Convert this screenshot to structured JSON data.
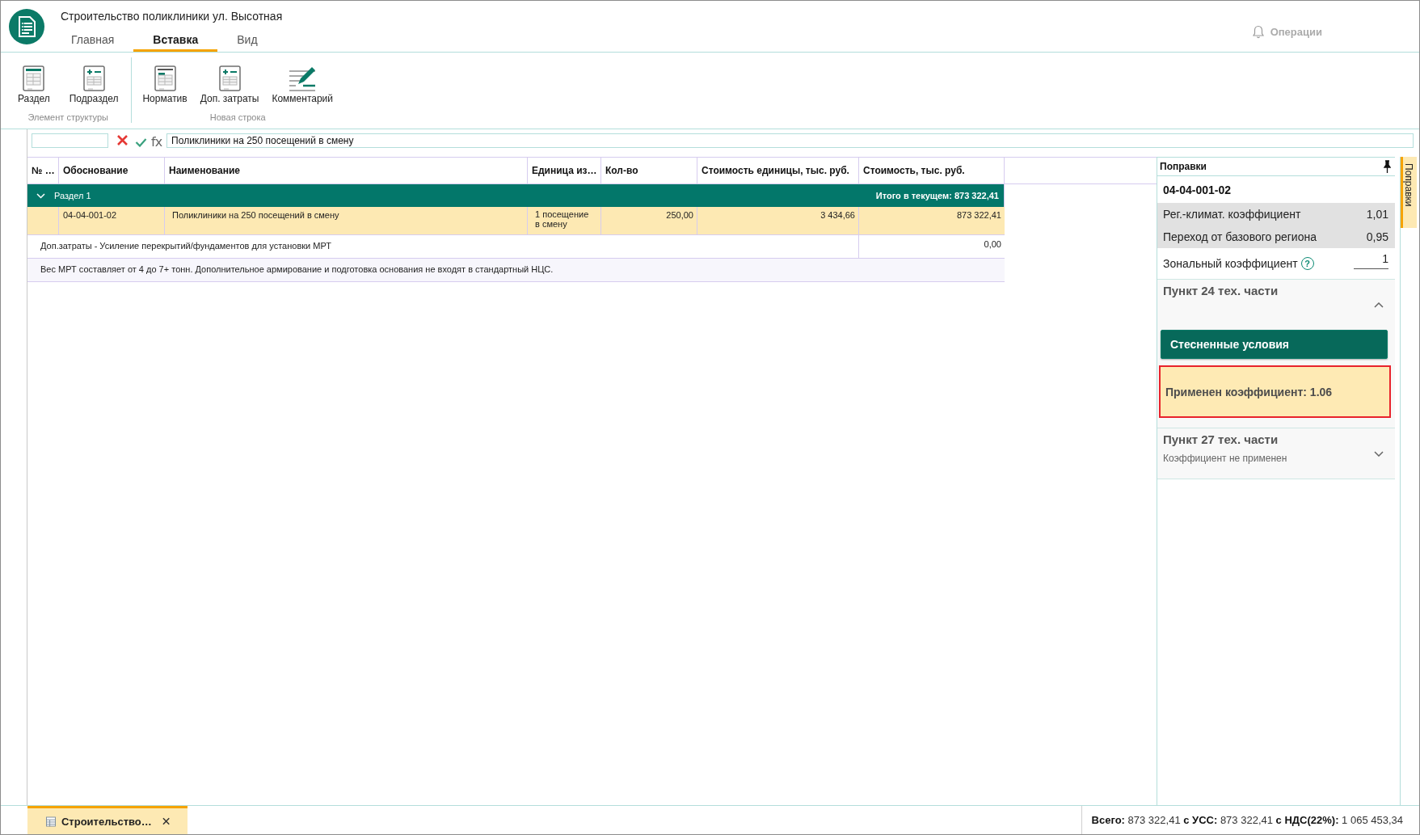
{
  "window": {
    "title": "Строительство поликлиники ул. Высотная"
  },
  "tabs": [
    {
      "label": "Главная",
      "selected": false
    },
    {
      "label": "Вставка",
      "selected": true
    },
    {
      "label": "Вид",
      "selected": false
    }
  ],
  "operations": {
    "label": "Операции"
  },
  "ribbon": {
    "groups": [
      {
        "label": "Элемент структуры",
        "buttons": [
          {
            "label": "Раздел",
            "kind": "section"
          },
          {
            "label": "Подраздел",
            "kind": "subsection"
          }
        ]
      },
      {
        "label": "Новая строка",
        "buttons": [
          {
            "label": "Норматив",
            "kind": "norm"
          },
          {
            "label": "Доп. затраты",
            "kind": "extra"
          },
          {
            "label": "Комментарий",
            "kind": "comment"
          }
        ]
      }
    ]
  },
  "formula_bar": {
    "function_label": "fx",
    "value": "Поликлиники на 250 посещений в смену"
  },
  "table": {
    "columns": [
      "№ …",
      "Обоснование",
      "Наименование",
      "Единица из…",
      "Кол-во",
      "Стоимость единицы, тыс. руб.",
      "Стоимость, тыс. руб."
    ],
    "section": {
      "label": "Раздел 1",
      "expanded": true,
      "total": "Итого в текущем: 873 322,41"
    },
    "rows": [
      {
        "kind": "item",
        "selected": true,
        "code": "04-04-001-02",
        "name": "Поликлиники на 250 посещений в смену",
        "unit": "1 посещение в смену",
        "quantity": "250,00",
        "unit_cost": "3 434,66",
        "cost": "873 322,41"
      },
      {
        "kind": "extra",
        "selected": false,
        "text": "Доп.затраты - Усиление перекрытий/фундаментов для установки МРТ",
        "cost": "0,00"
      },
      {
        "kind": "comment",
        "selected": false,
        "text": "Вес МРТ составляет от 4 до 7+ тонн. Дополнительное армирование и подготовка основания не входят в стандартный НЦС."
      }
    ]
  },
  "corrections_panel": {
    "title": "Поправки",
    "code": "04-04-001-02",
    "coefficients": [
      {
        "kind": "fixed",
        "label": "Рег.-климат. коэффициент",
        "value": "1,01"
      },
      {
        "kind": "fixed",
        "label": "Переход от базового региона",
        "value": "0,95"
      },
      {
        "kind": "input",
        "label": "Зональный коэффициент",
        "help": "?",
        "value": "1"
      }
    ],
    "sections": [
      {
        "title": "Пункт 24 тех. части",
        "expanded": true,
        "options": [
          {
            "label": "Стесненные условия",
            "selected": true
          }
        ],
        "note": "Применен коэффициент: 1.06"
      },
      {
        "title": "Пункт 27 тех. части",
        "expanded": false,
        "subtitle": "Коэффициент не применен"
      }
    ]
  },
  "side_tab": {
    "label": "Поправки",
    "selected": true
  },
  "document_tabs": [
    {
      "label": "Строительство…",
      "selected": true
    }
  ],
  "status_bar": {
    "totals": "**Всего:** 873 322,41 **с УСС:** 873 322,41 **с НДС(22%):** 1 065 453,34"
  }
}
